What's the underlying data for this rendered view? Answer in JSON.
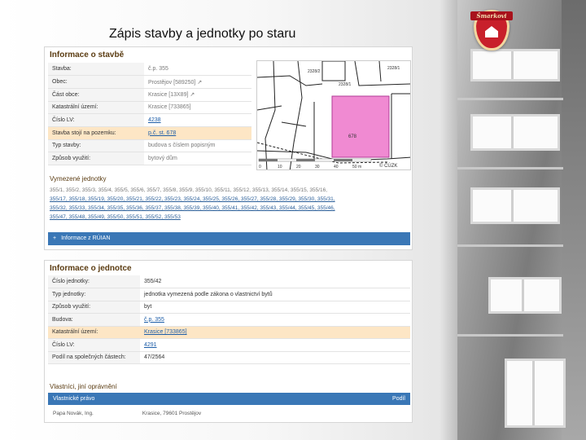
{
  "slide": {
    "title": "Zápis stavby a jednotky po staru"
  },
  "logo": {
    "ribbon_text": "Šmarkovi"
  },
  "building_info": {
    "heading": "Informace o stavbě",
    "rows": [
      {
        "label": "Stavba:",
        "value": "č.p. 355"
      },
      {
        "label": "Obec:",
        "value": "Prostějov [589250] ↗"
      },
      {
        "label": "Část obce:",
        "value": "Krasice [13X89] ↗"
      },
      {
        "label": "Katastrální území:",
        "value": "Krasice [733865]"
      },
      {
        "label": "Číslo LV:",
        "value": "4238"
      },
      {
        "label": "Stavba stojí na pozemku:",
        "value": "p.č. st. 678"
      },
      {
        "label": "Typ stavby:",
        "value": "budova s číslem popisným"
      },
      {
        "label": "Způsob využití:",
        "value": "bytový dům"
      }
    ]
  },
  "map": {
    "parcel_label": "678",
    "labels": [
      "2328/1",
      "2328/2",
      "2328/1"
    ],
    "scale": [
      "0",
      "10",
      "20",
      "30",
      "40",
      "50 m"
    ],
    "copyright": "© ČÚZK"
  },
  "units": {
    "heading": "Vymezené jednotky",
    "lines": [
      "355/1, 355/2, 355/3, 355/4, 355/5, 355/6, 355/7, 355/8, 355/9, 355/10, 355/11, 355/12, 355/13, 355/14, 355/15, 355/16,",
      "355/17, 355/18, 355/19, 355/20, 355/21, 355/22, 355/23, 355/24, 355/25, 355/26, 355/27, 355/28, 355/29, 355/30, 355/31,",
      "355/32, 355/33, 355/34, 355/35, 355/36, 355/37, 355/38, 355/39, 355/40, 355/41, 355/42, 355/43, 355/44, 355/45, 355/46,",
      "355/47, 355/48, 355/49, 355/50, 355/51, 355/52, 355/53"
    ],
    "ruian_label": "Informace z RÚIAN",
    "ruian_icon": "+"
  },
  "unit_info": {
    "heading": "Informace o jednotce",
    "rows": [
      {
        "label": "Číslo jednotky:",
        "value": "355/42"
      },
      {
        "label": "Typ jednotky:",
        "value": "jednotka vymezená podle zákona o vlastnictví bytů"
      },
      {
        "label": "Způsob využití:",
        "value": "byt"
      },
      {
        "label": "Budova:",
        "value": "č.p. 355"
      },
      {
        "label": "Katastrální území:",
        "value": "Krasice [733865]"
      },
      {
        "label": "Číslo LV:",
        "value": "4291"
      },
      {
        "label": "Podíl na společných částech:",
        "value": "47/2564"
      }
    ]
  },
  "ownership": {
    "heading": "Vlastníci, jiní oprávnění",
    "col_left": "Vlastnické právo",
    "col_right": "Podíl",
    "owner_name": "Papa Novák, Ing.",
    "owner_address": "Krasice, 79601 Prostějov"
  }
}
